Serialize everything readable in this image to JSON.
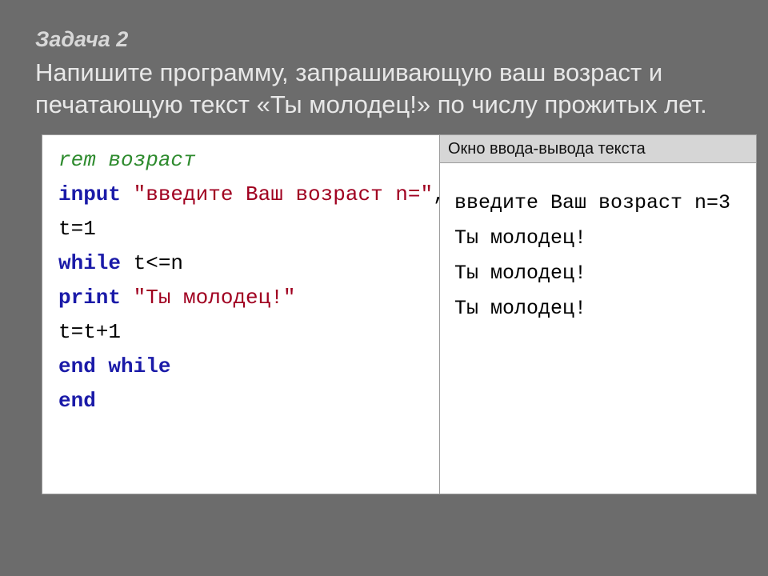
{
  "slide": {
    "title": "Задача 2",
    "description": "Напишите программу, запрашивающую ваш возраст и печатающую текст «Ты молодец!» по числу прожитых лет."
  },
  "code": {
    "l1_rem": "rem возраст",
    "l2_kw": "input",
    "l2_str": " \"введите Ваш возраст n=\"",
    "l2_rest": ",n",
    "l3": "t=1",
    "l4_kw": "while",
    "l4_rest": " t<=n",
    "l5_kw": "print",
    "l5_str": " \"Ты молодец!\"",
    "l6": "t=t+1",
    "l7_kw": "end while",
    "l8_kw": "end"
  },
  "io": {
    "title": "Окно ввода-вывода текста",
    "lines": {
      "l1": "введите Ваш возраст n=3",
      "l2": "Ты молодец!",
      "l3": "Ты молодец!",
      "l4": "Ты молодец!"
    }
  }
}
